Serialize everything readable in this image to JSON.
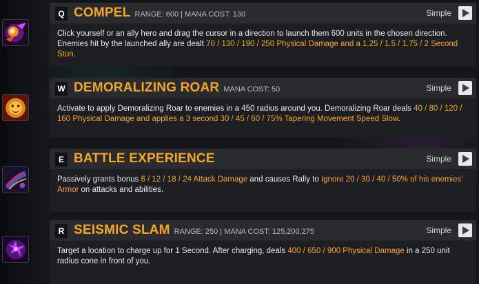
{
  "colors": {
    "accent": "#f5a623",
    "card": "#2a2b2e",
    "body": "#1d1e21",
    "text": "#eaeaec"
  },
  "abilities": [
    {
      "key": "Q",
      "name": "COMPEL",
      "meta": "RANGE: 600 | MANA COST: 130",
      "simple": "Simple",
      "icon": "compel-icon",
      "desc": {
        "t1": "Click yourself or an ally hero and drag the cursor in a direction to launch them 600 units in the chosen direction. Enemies hit by the launched ally are dealt ",
        "h1": "70 / 130 / 190 / 250 Physical Damage and a 1.25 / 1.5 / 1.75 / 2 Second Stun",
        "t2": "."
      }
    },
    {
      "key": "W",
      "name": "DEMORALIZING ROAR",
      "meta": "MANA COST: 50",
      "simple": "Simple",
      "icon": "lion-roar-icon",
      "desc": {
        "t1": "Activate to apply Demoralizing Roar to enemies in a 450 radius around you. Demoralizing Roar deals ",
        "h1": "40 / 80 / 120 / 160 Physical Damage and applies a 3 second 30 / 45 / 60 / 75% Tapering Movement Speed Slow",
        "t2": "."
      }
    },
    {
      "key": "E",
      "name": "BATTLE EXPERIENCE",
      "meta": "",
      "simple": "Simple",
      "icon": "battle-experience-icon",
      "desc": {
        "t1": "Passively grants bonus ",
        "h1": "6 / 12 / 18 / 24 Attack Damage",
        "t2": " and causes Rally to ",
        "h2": "Ignore 20 / 30 / 40 / 50% of his enemies' Armor",
        "t3": " on attacks and abilities."
      }
    },
    {
      "key": "R",
      "name": "SEISMIC SLAM",
      "meta": "RANGE: 250 | MANA COST: 125,200,275",
      "simple": "Simple",
      "icon": "seismic-slam-icon",
      "desc": {
        "t1": "Target a location to charge up for 1 Second. After charging, deals ",
        "h1": "400 / 650 / 900 Physical Damage",
        "t2": " in a 250 unit radius cone in front of you."
      }
    }
  ]
}
